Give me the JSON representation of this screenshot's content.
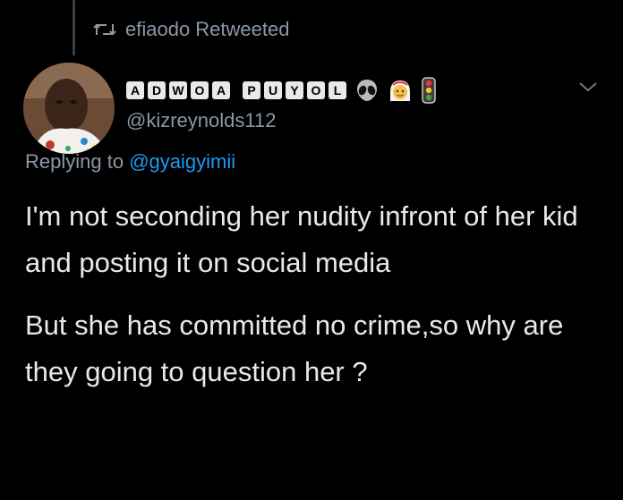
{
  "retweet": {
    "icon": "retweet-icon",
    "text": "efiaodo Retweeted"
  },
  "author": {
    "display_name_letters": [
      "A",
      "D",
      "W",
      "O",
      "A",
      "P",
      "U",
      "Y",
      "O",
      "L"
    ],
    "emoji_icons": [
      "alien-emoji-icon",
      "person-with-headscarf-emoji-icon",
      "traffic-light-icon"
    ],
    "handle": "@kizreynolds112",
    "avatar": "avatar-photo"
  },
  "reply": {
    "prefix": "Replying to",
    "mention": "@gyaigyimii"
  },
  "tweet": {
    "paragraph_1": "I'm not seconding her nudity infront of her kid and posting it on social media",
    "paragraph_2": "But she has committed no crime,so why are they going to question her ?"
  },
  "colors": {
    "background": "#000000",
    "text": "#e7e9ea",
    "muted": "#8b98a5",
    "link": "#1d9bf0"
  }
}
